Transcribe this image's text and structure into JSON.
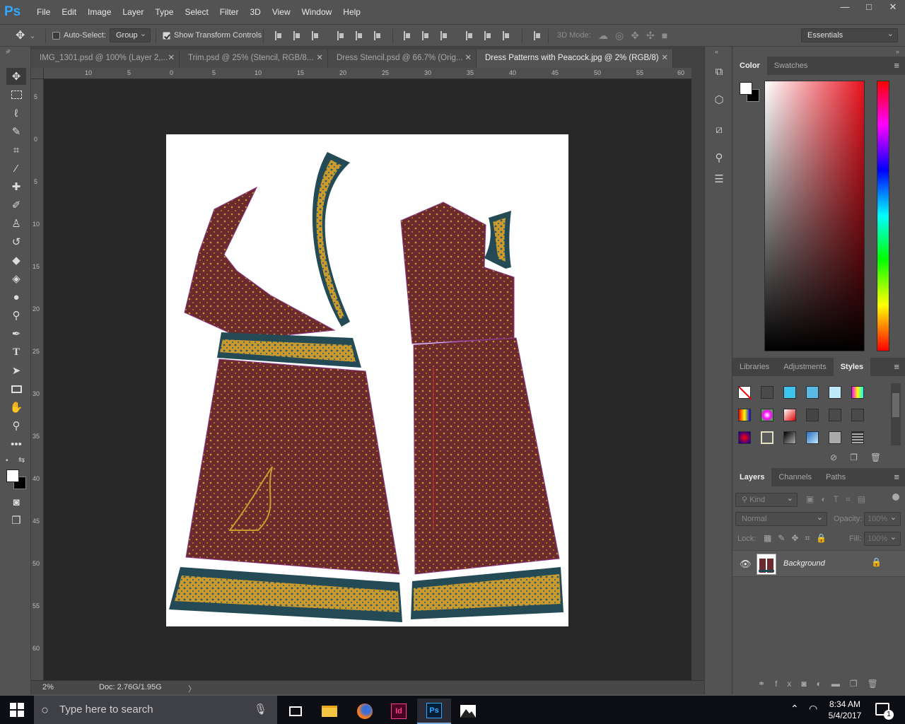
{
  "app": {
    "logo": "Ps"
  },
  "menus": [
    "File",
    "Edit",
    "Image",
    "Layer",
    "Type",
    "Select",
    "Filter",
    "3D",
    "View",
    "Window",
    "Help"
  ],
  "window_controls": {
    "minimize": "—",
    "maximize": "□",
    "close": "✕"
  },
  "options": {
    "auto_select_label": "Auto-Select:",
    "auto_select_checked": false,
    "auto_select_target": "Group",
    "show_transform_label": "Show Transform Controls",
    "show_transform_checked": true,
    "mode_3d_label": "3D Mode:",
    "workspace": "Essentials"
  },
  "tabs": [
    {
      "label": "IMG_1301.psd @ 100% (Layer 2,...",
      "close": "✕",
      "active": false
    },
    {
      "label": "Trim.psd @ 25% (Stencil, RGB/8...",
      "close": "✕",
      "active": false
    },
    {
      "label": "Dress Stencil.psd @ 66.7% (Orig...",
      "close": "✕",
      "active": false
    },
    {
      "label": "Dress Patterns with Peacock.jpg @ 2% (RGB/8)",
      "close": "✕",
      "active": true
    }
  ],
  "ruler_top_labels": [
    "10",
    "5",
    "0",
    "5",
    "10",
    "15",
    "20",
    "25",
    "30",
    "35",
    "40",
    "45",
    "50",
    "55",
    "60"
  ],
  "ruler_left_labels": [
    "5",
    "0",
    "5",
    "10",
    "15",
    "20",
    "25",
    "30",
    "35",
    "40",
    "45",
    "50",
    "55",
    "60"
  ],
  "status": {
    "zoom": "2%",
    "doc_info": "Doc: 2.76G/1.95G",
    "arrow": "〉"
  },
  "panels": {
    "color_tabs": [
      "Color",
      "Swatches"
    ],
    "styles_tabs": [
      "Libraries",
      "Adjustments",
      "Styles"
    ],
    "layers_tabs": [
      "Layers",
      "Channels",
      "Paths"
    ],
    "layers": {
      "filter_kind": "Kind",
      "blend_mode": "Normal",
      "opacity_label": "Opacity:",
      "opacity_value": "100%",
      "lock_label": "Lock:",
      "fill_label": "Fill:",
      "fill_value": "100%",
      "items": [
        {
          "name": "Background",
          "visible": true,
          "locked": true
        }
      ]
    }
  },
  "taskbar": {
    "search_placeholder": "Type here to search",
    "time": "8:34 AM",
    "date": "5/4/2017",
    "notification_count": "1",
    "apps": [
      "file-explorer",
      "firefox",
      "indesign",
      "photoshop",
      "photos"
    ],
    "indesign_label": "Id",
    "photoshop_label": "Ps"
  },
  "colors": {
    "fabric": "#6b2a2e",
    "trim_teal": "#244a55",
    "trim_gold": "#c99a2e",
    "accent": "#31a8ff"
  }
}
